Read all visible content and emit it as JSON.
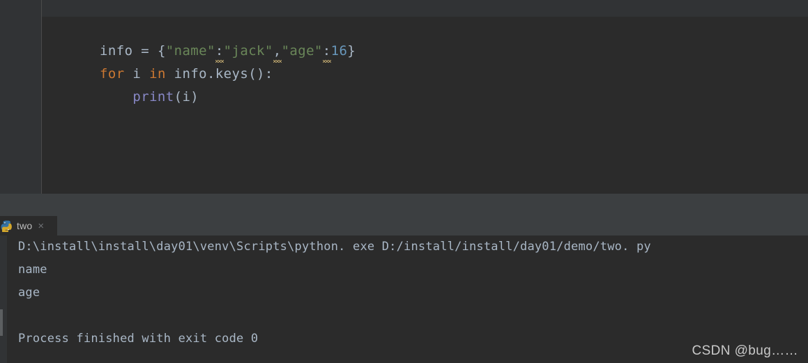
{
  "editor": {
    "language": "python",
    "lines": [
      {
        "tokens": [
          {
            "t": "info",
            "c": "ident"
          },
          {
            "t": " = ",
            "c": "punct"
          },
          {
            "t": "{",
            "c": "punct"
          },
          {
            "t": "\"name\"",
            "c": "str"
          },
          {
            "t": ":",
            "c": "punct",
            "warn": true
          },
          {
            "t": "\"jack\"",
            "c": "str"
          },
          {
            "t": ",",
            "c": "punct",
            "warn": true
          },
          {
            "t": "\"age\"",
            "c": "str"
          },
          {
            "t": ":",
            "c": "punct",
            "warn": true
          },
          {
            "t": "16",
            "c": "num"
          },
          {
            "t": "}",
            "c": "punct"
          }
        ]
      },
      {
        "tokens": [
          {
            "t": "for",
            "c": "kw"
          },
          {
            "t": " ",
            "c": "punct"
          },
          {
            "t": "i",
            "c": "ident"
          },
          {
            "t": " ",
            "c": "punct"
          },
          {
            "t": "in",
            "c": "kw"
          },
          {
            "t": " ",
            "c": "punct"
          },
          {
            "t": "info",
            "c": "ident"
          },
          {
            "t": ".",
            "c": "punct"
          },
          {
            "t": "keys",
            "c": "ident"
          },
          {
            "t": "():",
            "c": "punct"
          }
        ]
      },
      {
        "tokens": [
          {
            "t": "    ",
            "c": "punct"
          },
          {
            "t": "print",
            "c": "fn"
          },
          {
            "t": "(",
            "c": "punct"
          },
          {
            "t": "i",
            "c": "ident"
          },
          {
            "t": ")",
            "c": "punct"
          }
        ]
      }
    ]
  },
  "run_tool_window": {
    "tab": {
      "icon": "python-file-icon",
      "label": "two",
      "close_label": "×"
    },
    "console": {
      "lines": [
        "D:\\install\\install\\day01\\venv\\Scripts\\python. exe D:/install/install/day01/demo/two. py",
        "name",
        "age",
        "",
        "Process finished with exit code 0"
      ]
    }
  },
  "watermark": {
    "text": "CSDN @bug……"
  },
  "colors": {
    "editor_background": "#2b2b2b",
    "gutter_background": "#313335",
    "panel_background": "#3c3f41",
    "default_text": "#a9b7c6",
    "keyword": "#cc7832",
    "string": "#6a8759",
    "number": "#6897bb",
    "function": "#8888c6",
    "warning_squiggle": "#b9a26b",
    "tab_label": "#bbbbbb"
  }
}
